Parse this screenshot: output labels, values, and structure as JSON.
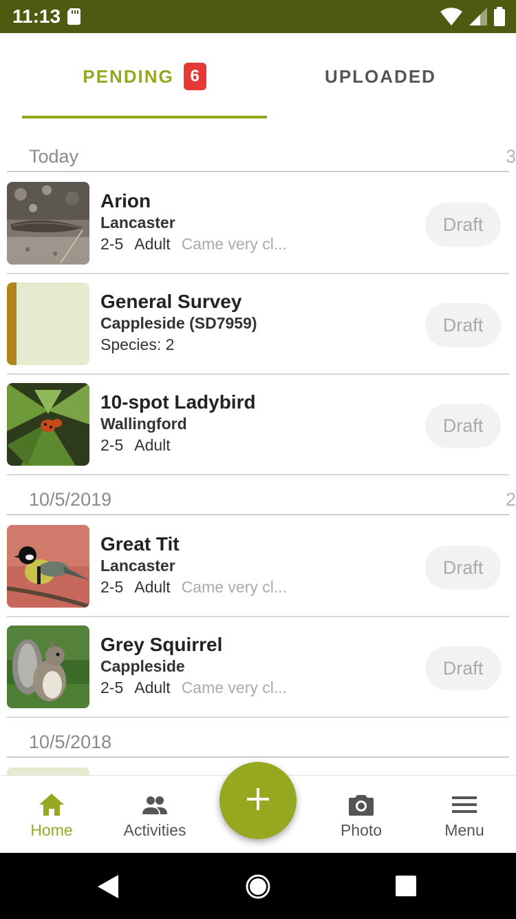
{
  "status_bar": {
    "time": "11:13"
  },
  "tabs": {
    "pending": {
      "label": "PENDING",
      "badge": "6"
    },
    "uploaded": {
      "label": "UPLOADED"
    }
  },
  "sections": [
    {
      "title": "Today",
      "count": "3"
    },
    {
      "title": "10/5/2019",
      "count": "2"
    },
    {
      "title": "10/5/2018",
      "count": ""
    }
  ],
  "records": [
    {
      "title": "Arion",
      "location": "Lancaster",
      "quantity": "2-5",
      "stage": "Adult",
      "comment": "Came very cl...",
      "status": "Draft",
      "thumbnail": "slug-photo"
    },
    {
      "title": "General Survey",
      "location": "Cappleside (SD7959)",
      "species_line": "Species: 2",
      "status": "Draft",
      "thumbnail": "survey-placeholder"
    },
    {
      "title": "10-spot Ladybird",
      "location": "Wallingford",
      "quantity": "2-5",
      "stage": "Adult",
      "comment": "",
      "status": "Draft",
      "thumbnail": "ladybird-photo"
    },
    {
      "title": "Great Tit",
      "location": "Lancaster",
      "quantity": "2-5",
      "stage": "Adult",
      "comment": "Came very cl...",
      "status": "Draft",
      "thumbnail": "bird-photo"
    },
    {
      "title": "Grey Squirrel",
      "location": "Cappleside",
      "quantity": "2-5",
      "stage": "Adult",
      "comment": "Came very cl...",
      "status": "Draft",
      "thumbnail": "squirrel-photo"
    }
  ],
  "bottom_nav": {
    "home": "Home",
    "activities": "Activities",
    "photo": "Photo",
    "menu": "Menu"
  },
  "colors": {
    "accent": "#96a720",
    "status_bar": "#4f5a10",
    "badge": "#e53935"
  }
}
